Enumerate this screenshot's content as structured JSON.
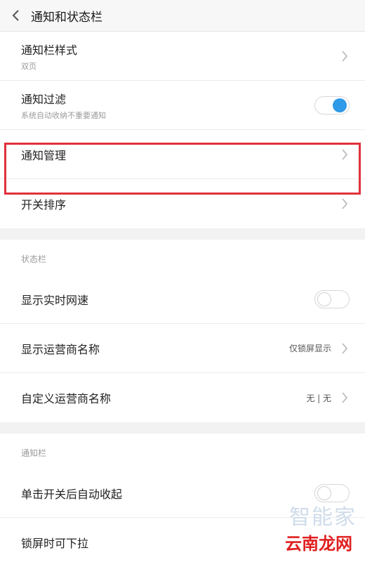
{
  "header": {
    "title": "通知和状态栏",
    "back_icon": "chevron-left-icon"
  },
  "notification_group": {
    "items": [
      {
        "label": "通知栏样式",
        "sub": "双页"
      },
      {
        "label": "通知过滤",
        "sub": "系统自动收纳不重要通知",
        "toggle": "on"
      },
      {
        "label": "通知管理"
      },
      {
        "label": "开关排序"
      }
    ]
  },
  "status_bar_group": {
    "header": "状态栏",
    "items": [
      {
        "label": "显示实时网速",
        "toggle": "off"
      },
      {
        "label": "显示运营商名称",
        "value": "仅锁屏显示"
      },
      {
        "label": "自定义运营商名称",
        "value": "无 | 无"
      }
    ]
  },
  "notification_bar_group": {
    "header": "通知栏",
    "items": [
      {
        "label": "单击开关后自动收起",
        "toggle": "off"
      },
      {
        "label": "锁屏时可下拉"
      }
    ]
  },
  "watermarks": {
    "top": "智能家",
    "bottom": "云南龙网"
  },
  "colors": {
    "accent": "#2f9ae8",
    "highlight": "#e0323b"
  }
}
